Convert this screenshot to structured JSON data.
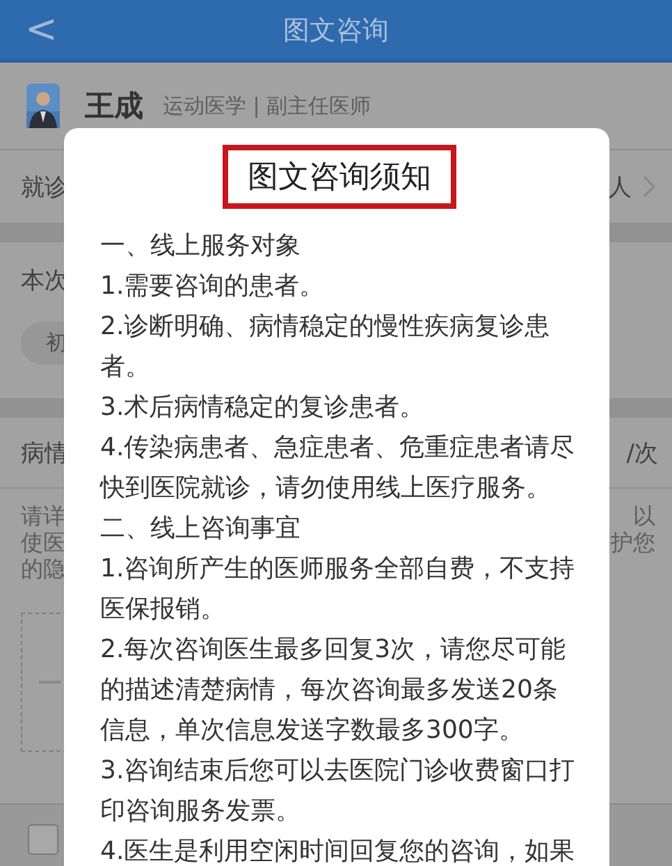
{
  "header": {
    "back": "<",
    "title": "图文咨询"
  },
  "doctor": {
    "name": "王成",
    "info": "运动医学 | 副主任医师"
  },
  "background_rows": {
    "visit_label": "就诊",
    "visit_value": "人",
    "this_label": "本次",
    "chip": "初",
    "condition_label": "病情",
    "price": "/次",
    "hint_left": [
      "请详",
      "使医",
      "的隐"
    ],
    "hint_right": [
      "以",
      "护您"
    ]
  },
  "agree_checkbox": {
    "checked": false
  },
  "notice": {
    "title": "图文咨询须知",
    "paragraphs": [
      "一、线上服务对象",
      "1.需要咨询的患者。",
      "2.诊断明确、病情稳定的慢性疾病复诊患者。",
      "3.术后病情稳定的复诊患者。",
      "4.传染病患者、急症患者、危重症患者请尽快到医院就诊，请勿使用线上医疗服务。",
      "二、线上咨询事宜",
      "1.咨询所产生的医师服务全部自费，不支持医保报销。",
      "2.每次咨询医生最多回复3次，请您尽可能的描述清楚病情，每次咨询最多发送20条信息，单次信息发送字数最多300字。",
      "3.咨询结束后您可以去医院门诊收费窗口打印咨询服务发票。",
      "4.医生是利用空闲时间回复您的咨询，如果"
    ]
  }
}
